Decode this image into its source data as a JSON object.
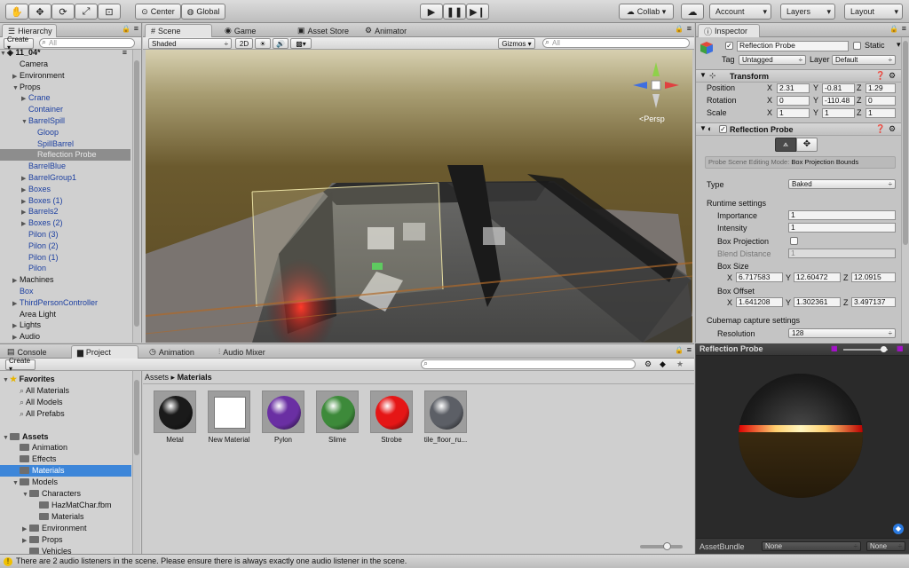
{
  "toolbar": {
    "pivot": "Center",
    "space": "Global",
    "collab": "Collab ▾",
    "account": "Account",
    "layers": "Layers",
    "layout": "Layout"
  },
  "hierarchy": {
    "tab": "Hierarchy",
    "create": "Create ▾",
    "search_placeholder": "All",
    "scene": "11_04*",
    "items": [
      {
        "label": "Camera",
        "indent": 1,
        "arrow": "",
        "color": "black"
      },
      {
        "label": "Environment",
        "indent": 1,
        "arrow": "▶",
        "color": "black"
      },
      {
        "label": "Props",
        "indent": 1,
        "arrow": "▼",
        "color": "black"
      },
      {
        "label": "Crane",
        "indent": 2,
        "arrow": "▶",
        "color": "blue"
      },
      {
        "label": "Container",
        "indent": 2,
        "arrow": "",
        "color": "blue"
      },
      {
        "label": "BarrelSpill",
        "indent": 2,
        "arrow": "▼",
        "color": "blue"
      },
      {
        "label": "Gloop",
        "indent": 3,
        "arrow": "",
        "color": "blue"
      },
      {
        "label": "SpillBarrel",
        "indent": 3,
        "arrow": "",
        "color": "blue"
      },
      {
        "label": "Reflection Probe",
        "indent": 3,
        "arrow": "",
        "color": "black",
        "selected": true
      },
      {
        "label": "BarrelBlue",
        "indent": 2,
        "arrow": "",
        "color": "blue"
      },
      {
        "label": "BarrelGroup1",
        "indent": 2,
        "arrow": "▶",
        "color": "blue"
      },
      {
        "label": "Boxes",
        "indent": 2,
        "arrow": "▶",
        "color": "blue"
      },
      {
        "label": "Boxes (1)",
        "indent": 2,
        "arrow": "▶",
        "color": "blue"
      },
      {
        "label": "Barrels2",
        "indent": 2,
        "arrow": "▶",
        "color": "blue"
      },
      {
        "label": "Boxes (2)",
        "indent": 2,
        "arrow": "▶",
        "color": "blue"
      },
      {
        "label": "Pilon (3)",
        "indent": 2,
        "arrow": "",
        "color": "blue"
      },
      {
        "label": "Pilon (2)",
        "indent": 2,
        "arrow": "",
        "color": "blue"
      },
      {
        "label": "Pilon (1)",
        "indent": 2,
        "arrow": "",
        "color": "blue"
      },
      {
        "label": "Pilon",
        "indent": 2,
        "arrow": "",
        "color": "blue"
      },
      {
        "label": "Machines",
        "indent": 1,
        "arrow": "▶",
        "color": "black"
      },
      {
        "label": "Box",
        "indent": 1,
        "arrow": "",
        "color": "blue"
      },
      {
        "label": "ThirdPersonController",
        "indent": 1,
        "arrow": "▶",
        "color": "blue"
      },
      {
        "label": "Area Light",
        "indent": 1,
        "arrow": "",
        "color": "black"
      },
      {
        "label": "Lights",
        "indent": 1,
        "arrow": "▶",
        "color": "black"
      },
      {
        "label": "Audio",
        "indent": 1,
        "arrow": "▶",
        "color": "black"
      }
    ]
  },
  "scene": {
    "tabs": [
      "Scene",
      "Game",
      "Asset Store",
      "Animator"
    ],
    "shading": "Shaded",
    "mode_2d": "2D",
    "gizmos": "Gizmos ▾",
    "search_placeholder": "All",
    "persp": "Persp"
  },
  "inspector": {
    "tab": "Inspector",
    "object_name": "Reflection Probe",
    "static_label": "Static",
    "tag_label": "Tag",
    "tag_value": "Untagged",
    "layer_label": "Layer",
    "layer_value": "Default",
    "transform": {
      "title": "Transform",
      "position_label": "Position",
      "rotation_label": "Rotation",
      "scale_label": "Scale",
      "position": {
        "x": "2.31",
        "y": "-0.81",
        "z": "1.29"
      },
      "rotation": {
        "x": "0",
        "y": "-110.48",
        "z": "0"
      },
      "scale": {
        "x": "1",
        "y": "1",
        "z": "1"
      }
    },
    "probe": {
      "title": "Reflection Probe",
      "edit_mode_label": "Probe Scene Editing Mode:",
      "edit_mode_value": "Box Projection Bounds",
      "type_label": "Type",
      "type_value": "Baked",
      "runtime_label": "Runtime settings",
      "importance_label": "Importance",
      "importance": "1",
      "intensity_label": "Intensity",
      "intensity": "1",
      "box_projection_label": "Box Projection",
      "blend_distance_label": "Blend Distance",
      "blend_distance": "1",
      "box_size_label": "Box Size",
      "box_size": {
        "x": "6.717583",
        "y": "12.60472",
        "z": "12.0915"
      },
      "box_offset_label": "Box Offset",
      "box_offset": {
        "x": "1.641208",
        "y": "1.302361",
        "z": "3.497137"
      },
      "cubemap_label": "Cubemap capture settings",
      "resolution_label": "Resolution",
      "resolution": "128"
    }
  },
  "project": {
    "tabs": [
      "Console",
      "Project",
      "Animation",
      "Audio Mixer"
    ],
    "create": "Create ▾",
    "breadcrumb_root": "Assets",
    "breadcrumb_leaf": "Materials",
    "tree": [
      {
        "label": "Favorites",
        "indent": 0,
        "arrow": "▼",
        "type": "star",
        "bold": true
      },
      {
        "label": "All Materials",
        "indent": 1,
        "arrow": "",
        "type": "search"
      },
      {
        "label": "All Models",
        "indent": 1,
        "arrow": "",
        "type": "search"
      },
      {
        "label": "All Prefabs",
        "indent": 1,
        "arrow": "",
        "type": "search"
      },
      {
        "label": "",
        "indent": 0,
        "arrow": "",
        "type": "gap"
      },
      {
        "label": "Assets",
        "indent": 0,
        "arrow": "▼",
        "type": "folder",
        "bold": true
      },
      {
        "label": "Animation",
        "indent": 1,
        "arrow": "",
        "type": "folder"
      },
      {
        "label": "Effects",
        "indent": 1,
        "arrow": "",
        "type": "folder"
      },
      {
        "label": "Materials",
        "indent": 1,
        "arrow": "",
        "type": "folder",
        "selected": true
      },
      {
        "label": "Models",
        "indent": 1,
        "arrow": "▼",
        "type": "folder"
      },
      {
        "label": "Characters",
        "indent": 2,
        "arrow": "▼",
        "type": "folder"
      },
      {
        "label": "HazMatChar.fbm",
        "indent": 3,
        "arrow": "",
        "type": "folder"
      },
      {
        "label": "Materials",
        "indent": 3,
        "arrow": "",
        "type": "folder"
      },
      {
        "label": "Environment",
        "indent": 2,
        "arrow": "▶",
        "type": "folder"
      },
      {
        "label": "Props",
        "indent": 2,
        "arrow": "▶",
        "type": "folder"
      },
      {
        "label": "Vehicles",
        "indent": 2,
        "arrow": "",
        "type": "folder"
      }
    ],
    "assets": [
      {
        "label": "Metal",
        "color": "#1a1a1a"
      },
      {
        "label": "New Material",
        "color": "#ffffff"
      },
      {
        "label": "Pylon",
        "color": "#6a2fa3"
      },
      {
        "label": "Slime",
        "color": "#3d8a3a"
      },
      {
        "label": "Strobe",
        "color": "#e51616"
      },
      {
        "label": "tile_floor_ru...",
        "color": "#5c5f66"
      }
    ]
  },
  "preview": {
    "title": "Reflection Probe",
    "asset_bundle_label": "AssetBundle",
    "bundle_value": "None",
    "variant_value": "None"
  },
  "status": {
    "message": "There are 2 audio listeners in the scene. Please ensure there is always exactly one audio listener in the scene."
  }
}
